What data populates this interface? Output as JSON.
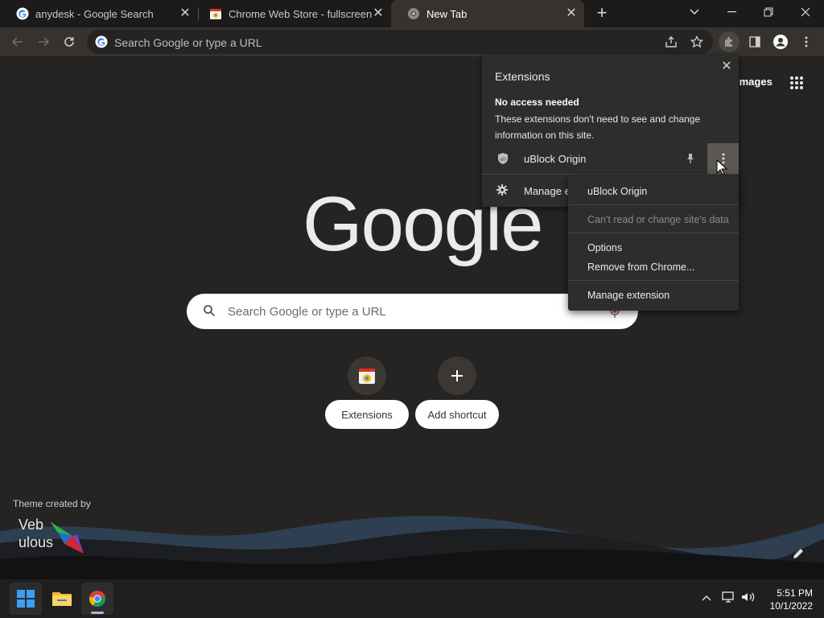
{
  "tabs": [
    {
      "title": "anydesk - Google Search",
      "favicon": "google-g-icon",
      "active": false
    },
    {
      "title": "Chrome Web Store - fullscreen m",
      "favicon": "web-store-icon",
      "active": false
    },
    {
      "title": "New Tab",
      "favicon": "chrome-icon",
      "active": true
    }
  ],
  "omnibox": {
    "placeholder": "Search Google or type a URL"
  },
  "ntp": {
    "images_link": "Images",
    "logo_text": "Google",
    "search_placeholder": "Search Google or type a URL",
    "shortcuts": [
      {
        "label": "Extensions",
        "icon": "web-store-icon"
      },
      {
        "label": "Add shortcut",
        "icon": "plus-icon"
      }
    ],
    "theme_credit": "Theme created by",
    "theme_brand_line1": "Veb",
    "theme_brand_line2": "ulous"
  },
  "extensions_popup": {
    "title": "Extensions",
    "section_title": "No access needed",
    "section_desc": "These extensions don't need to see and change information on this site.",
    "items": [
      {
        "name": "uBlock Origin",
        "icon": "ublock-shield-icon"
      }
    ],
    "manage_label": "Manage extensions"
  },
  "context_menu": {
    "header": "uBlock Origin",
    "status": "Can't read or change site's data",
    "options": "Options",
    "remove": "Remove from Chrome...",
    "manage": "Manage extension"
  },
  "taskbar": {
    "time": "5:51 PM",
    "date": "10/1/2022"
  },
  "colors": {
    "background": "#262422",
    "toolbar": "#35322f",
    "popup": "#2f2d2b",
    "accent_underline": "#c9a6df"
  }
}
